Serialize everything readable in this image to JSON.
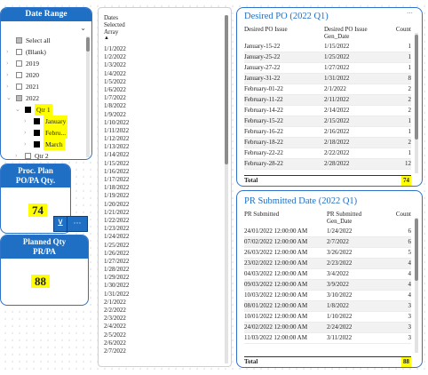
{
  "date_range_slicer": {
    "title": "Date Range",
    "items": [
      {
        "label": "Select all",
        "state": "partial",
        "level": 0,
        "toggle": ""
      },
      {
        "label": "(Blank)",
        "state": "off",
        "level": 0,
        "toggle": "›"
      },
      {
        "label": "2019",
        "state": "off",
        "level": 0,
        "toggle": "›"
      },
      {
        "label": "2020",
        "state": "off",
        "level": 0,
        "toggle": "›"
      },
      {
        "label": "2021",
        "state": "off",
        "level": 0,
        "toggle": "›"
      },
      {
        "label": "2022",
        "state": "partial",
        "level": 0,
        "toggle": "⌄"
      },
      {
        "label": "Qtr 1",
        "state": "on",
        "level": 1,
        "toggle": "⌄",
        "highlight": true
      },
      {
        "label": "January",
        "state": "on",
        "level": 2,
        "toggle": "›",
        "highlight": true
      },
      {
        "label": "Febru...",
        "state": "on",
        "level": 2,
        "toggle": "›",
        "highlight": true
      },
      {
        "label": "March",
        "state": "on",
        "level": 2,
        "toggle": "›",
        "highlight": true
      },
      {
        "label": "Qtr 2",
        "state": "off",
        "level": 1,
        "toggle": "›"
      }
    ]
  },
  "proc_plan_card": {
    "title_line1": "Proc. Plan",
    "title_line2": "PO/PA Qty.",
    "value": "74"
  },
  "planned_qty_card": {
    "title_line1": "Planned Qty",
    "title_line2": "PR/PA",
    "value": "88"
  },
  "dates_table": {
    "header": [
      "Dates",
      "Selected",
      "Array"
    ],
    "rows": [
      "1/1/2022",
      "1/2/2022",
      "1/3/2022",
      "1/4/2022",
      "1/5/2022",
      "1/6/2022",
      "1/7/2022",
      "1/8/2022",
      "1/9/2022",
      "1/10/2022",
      "1/11/2022",
      "1/12/2022",
      "1/13/2022",
      "1/14/2022",
      "1/15/2022",
      "1/16/2022",
      "1/17/2022",
      "1/18/2022",
      "1/19/2022",
      "1/20/2022",
      "1/21/2022",
      "1/22/2022",
      "1/23/2022",
      "1/24/2022",
      "1/25/2022",
      "1/26/2022",
      "1/27/2022",
      "1/28/2022",
      "1/29/2022",
      "1/30/2022",
      "1/31/2022",
      "2/1/2022",
      "2/2/2022",
      "2/3/2022",
      "2/4/2022",
      "2/5/2022",
      "2/6/2022",
      "2/7/2022"
    ]
  },
  "desired_po_table": {
    "title": "Desired PO (2022 Q1)",
    "columns": [
      "Desired PO Issue",
      "Desired PO Issue Gen_Date",
      "Count"
    ],
    "rows": [
      [
        "January-15-22",
        "1/15/2022",
        "1"
      ],
      [
        "January-25-22",
        "1/25/2022",
        "1"
      ],
      [
        "January-27-22",
        "1/27/2022",
        "1"
      ],
      [
        "January-31-22",
        "1/31/2022",
        "8"
      ],
      [
        "February-01-22",
        "2/1/2022",
        "2"
      ],
      [
        "February-11-22",
        "2/11/2022",
        "2"
      ],
      [
        "February-14-22",
        "2/14/2022",
        "2"
      ],
      [
        "February-15-22",
        "2/15/2022",
        "1"
      ],
      [
        "February-16-22",
        "2/16/2022",
        "1"
      ],
      [
        "February-18-22",
        "2/18/2022",
        "2"
      ],
      [
        "February-22-22",
        "2/22/2022",
        "1"
      ],
      [
        "February-28-22",
        "2/28/2022",
        "12"
      ]
    ],
    "total_label": "Total",
    "total_value": "74"
  },
  "pr_submitted_table": {
    "title": "PR Submitted Date (2022 Q1)",
    "columns": [
      "PR Submitted",
      "PR Submitted Gen_Date",
      "Count"
    ],
    "rows": [
      [
        "24/01/2022 12:00:00 AM",
        "1/24/2022",
        "6"
      ],
      [
        "07/02/2022 12:00:00 AM",
        "2/7/2022",
        "6"
      ],
      [
        "26/03/2022 12:00:00 AM",
        "3/26/2022",
        "5"
      ],
      [
        "23/02/2022 12:00:00 AM",
        "2/23/2022",
        "4"
      ],
      [
        "04/03/2022 12:00:00 AM",
        "3/4/2022",
        "4"
      ],
      [
        "09/03/2022 12:00:00 AM",
        "3/9/2022",
        "4"
      ],
      [
        "10/03/2022 12:00:00 AM",
        "3/10/2022",
        "4"
      ],
      [
        "08/01/2022 12:00:00 AM",
        "1/8/2022",
        "3"
      ],
      [
        "10/01/2022 12:00:00 AM",
        "1/10/2022",
        "3"
      ],
      [
        "24/02/2022 12:00:00 AM",
        "2/24/2022",
        "3"
      ],
      [
        "11/03/2022 12:00:00 AM",
        "3/11/2022",
        "3"
      ]
    ],
    "total_label": "Total",
    "total_value": "88"
  }
}
